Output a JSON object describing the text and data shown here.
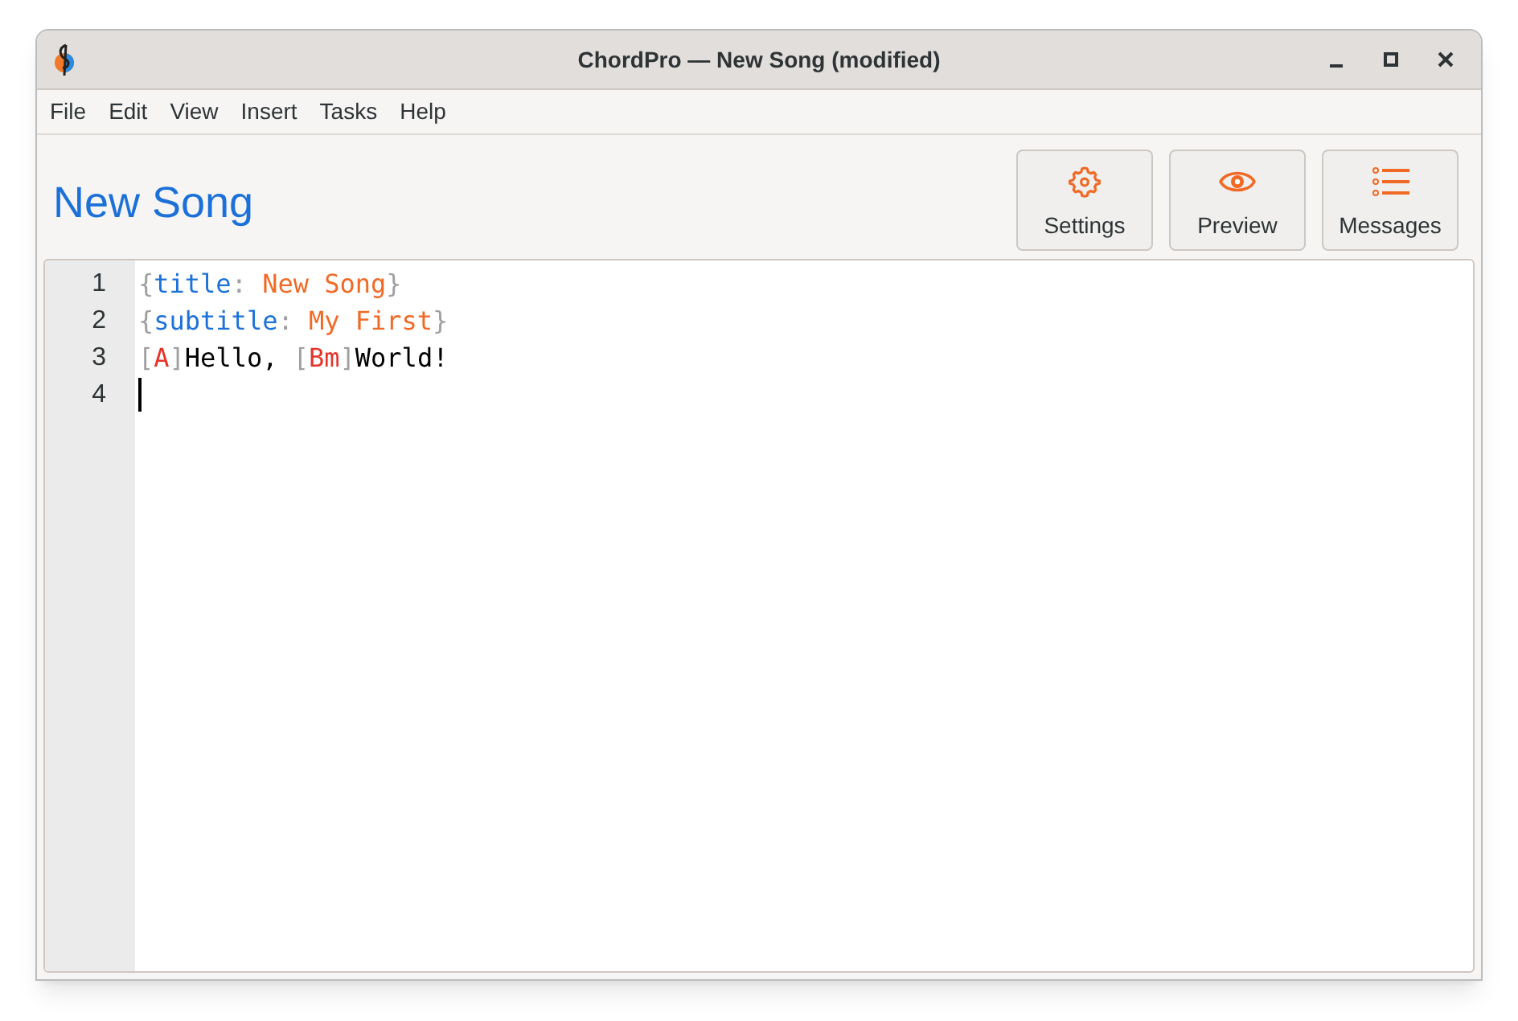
{
  "window": {
    "title": "ChordPro — New Song (modified)"
  },
  "menu": [
    "File",
    "Edit",
    "View",
    "Insert",
    "Tasks",
    "Help"
  ],
  "song_title": "New Song",
  "toolbar": [
    {
      "kind": "settings",
      "label": "Settings"
    },
    {
      "kind": "preview",
      "label": "Preview"
    },
    {
      "kind": "messages",
      "label": "Messages"
    }
  ],
  "editor": {
    "lines": [
      {
        "number": "1",
        "cursor": false,
        "tokens": [
          {
            "kind": "punct",
            "text": "{"
          },
          {
            "kind": "directive",
            "text": "title"
          },
          {
            "kind": "punct",
            "text": ": "
          },
          {
            "kind": "value",
            "text": "New Song"
          },
          {
            "kind": "punct",
            "text": "}"
          }
        ]
      },
      {
        "number": "2",
        "cursor": false,
        "tokens": [
          {
            "kind": "punct",
            "text": "{"
          },
          {
            "kind": "directive",
            "text": "subtitle"
          },
          {
            "kind": "punct",
            "text": ": "
          },
          {
            "kind": "value",
            "text": "My First"
          },
          {
            "kind": "punct",
            "text": "}"
          }
        ]
      },
      {
        "number": "3",
        "cursor": false,
        "tokens": [
          {
            "kind": "punct",
            "text": "["
          },
          {
            "kind": "chord",
            "text": "A"
          },
          {
            "kind": "punct",
            "text": "]"
          },
          {
            "kind": "lyric",
            "text": "Hello, "
          },
          {
            "kind": "punct",
            "text": "["
          },
          {
            "kind": "chord",
            "text": "Bm"
          },
          {
            "kind": "punct",
            "text": "]"
          },
          {
            "kind": "lyric",
            "text": "World!"
          }
        ]
      },
      {
        "number": "4",
        "cursor": true
      }
    ]
  }
}
